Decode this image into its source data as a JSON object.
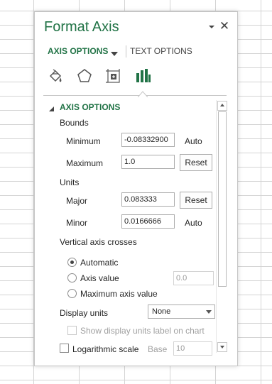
{
  "pane": {
    "title": "Format Axis",
    "close_glyph": "✕"
  },
  "tabs": {
    "axis_options": "AXIS OPTIONS",
    "text_options": "TEXT OPTIONS"
  },
  "category_icons": [
    "fill-line-icon",
    "effects-icon",
    "size-properties-icon",
    "axis-options-icon"
  ],
  "section": {
    "title": "AXIS OPTIONS",
    "bounds_label": "Bounds",
    "minimum_label": "Minimum",
    "minimum_value": "-0.08332900",
    "minimum_state": "Auto",
    "maximum_label": "Maximum",
    "maximum_value": "1.0",
    "maximum_reset": "Reset",
    "units_label": "Units",
    "major_label": "Major",
    "major_value": "0.083333",
    "major_reset": "Reset",
    "minor_label": "Minor",
    "minor_value": "0.0166666",
    "minor_state": "Auto",
    "vertical_crosses_label": "Vertical axis crosses",
    "radio_automatic": "Automatic",
    "radio_axis_value": "Axis value",
    "axis_value_input": "0.0",
    "radio_max": "Maximum axis value",
    "display_units_label": "Display units",
    "display_units_value": "None",
    "show_units_label": "Show display units label on chart",
    "log_scale_label": "Logarithmic scale",
    "base_label": "Base",
    "base_value": "10"
  },
  "colors": {
    "accent": "#217346"
  }
}
